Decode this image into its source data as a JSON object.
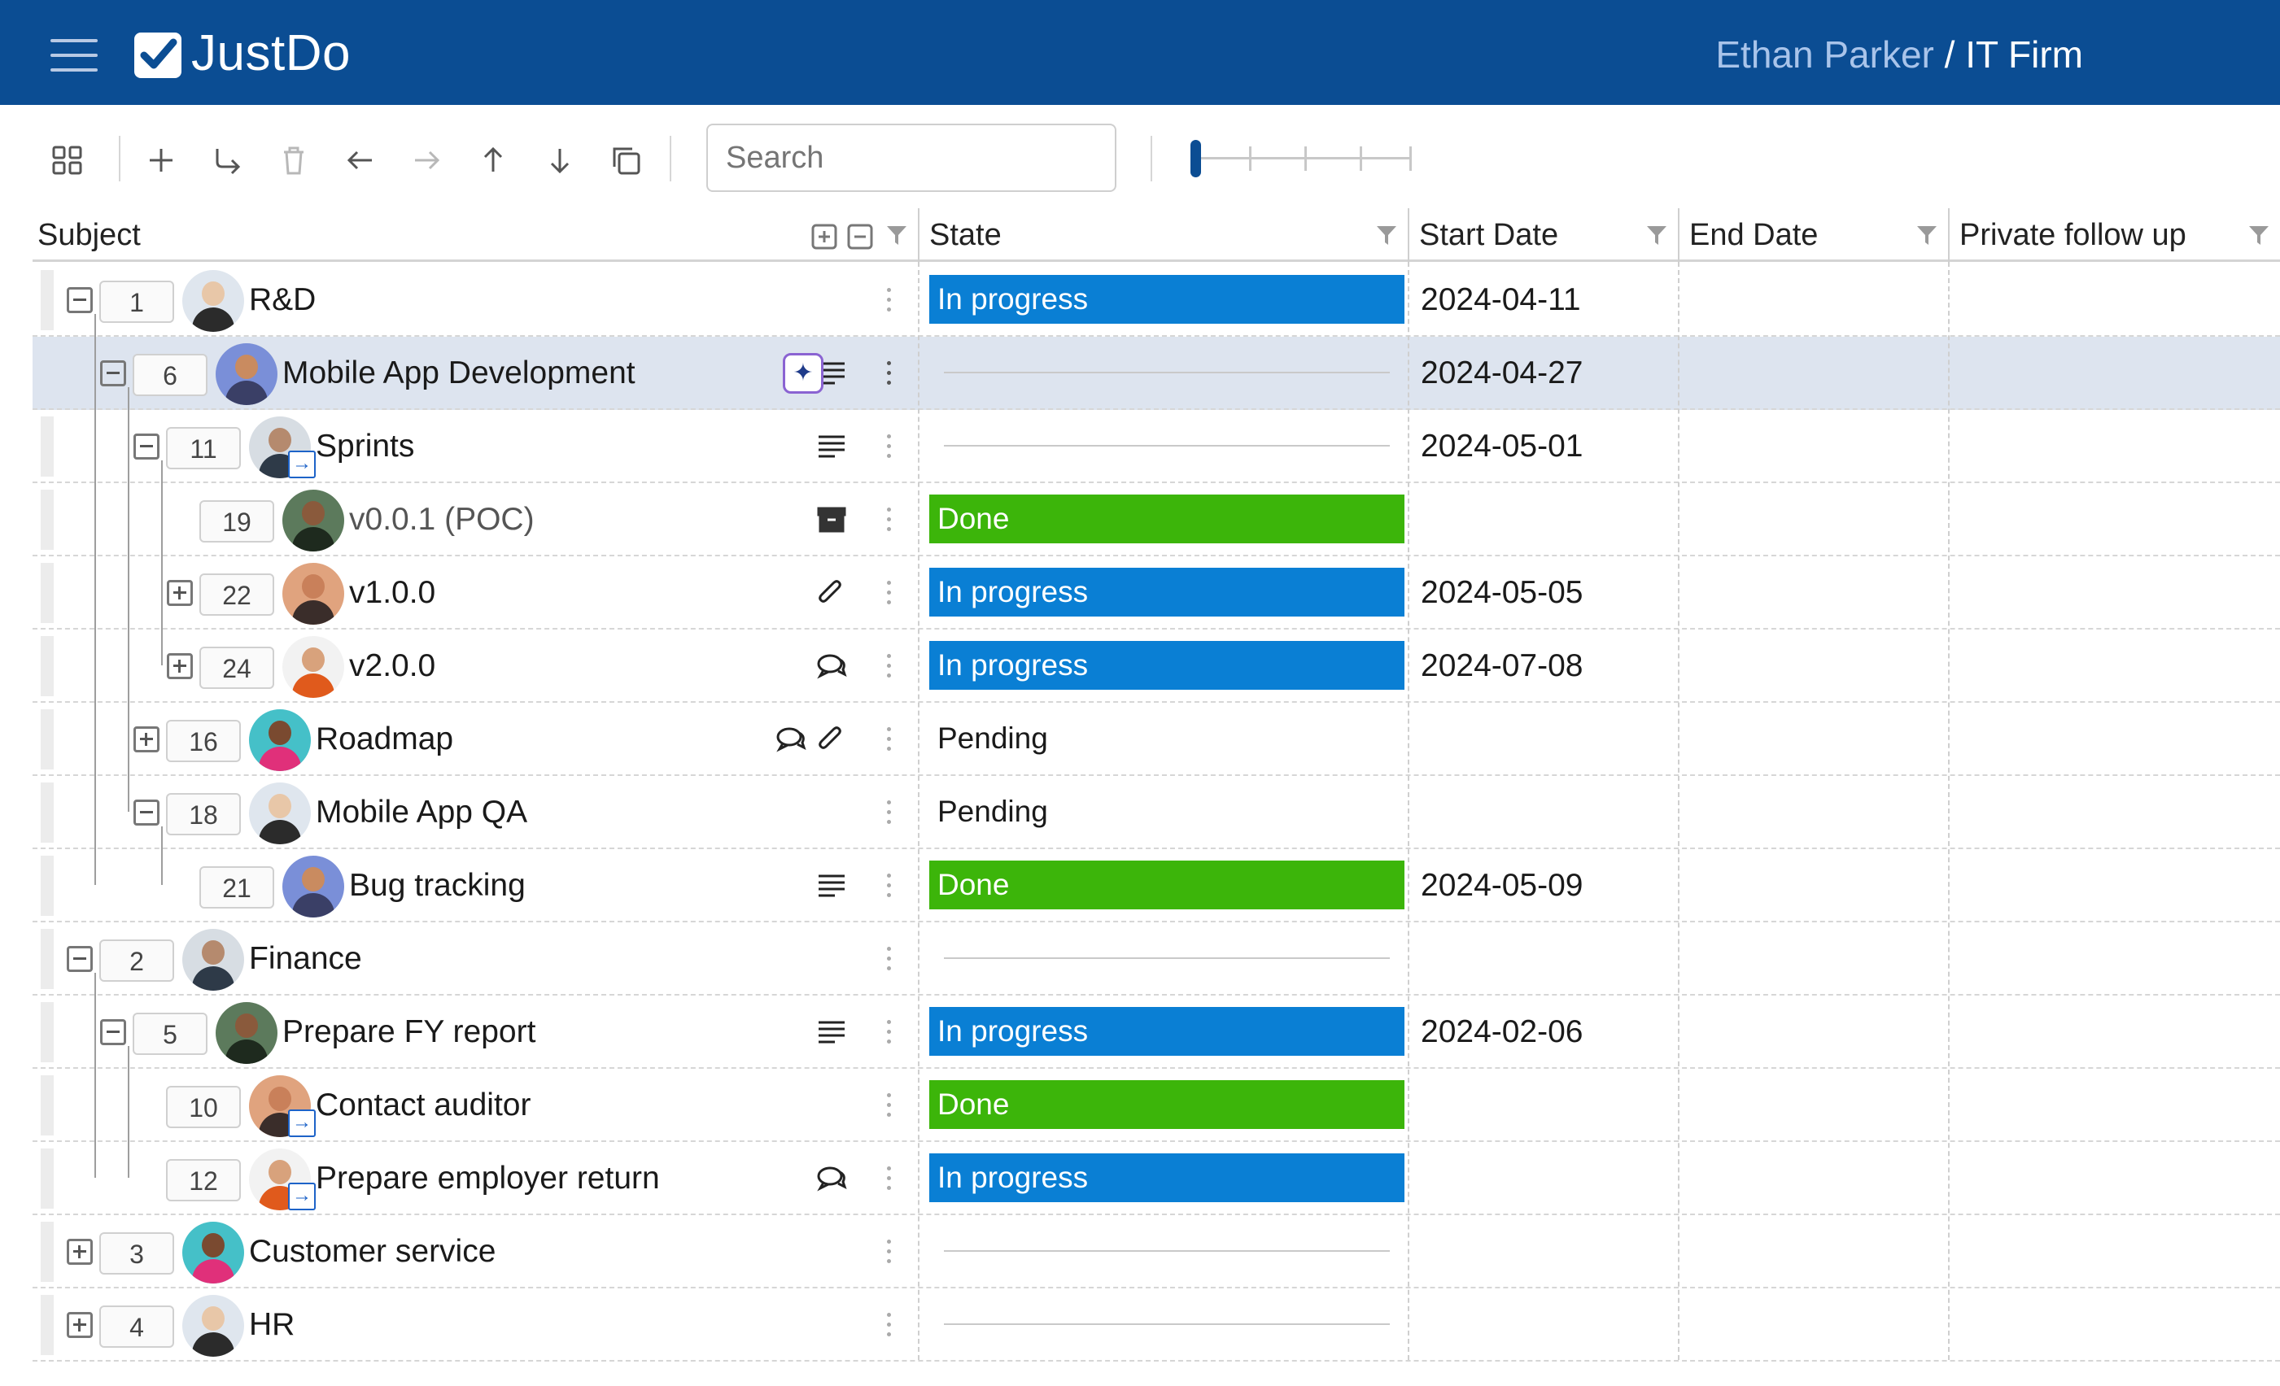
{
  "app": {
    "logo_text": "JustDo",
    "user_name": "Ethan Parker",
    "org_separator": " / ",
    "org_name": "IT Firm"
  },
  "toolbar": {
    "search_placeholder": "Search",
    "icons": [
      "grid-icon",
      "plus-icon",
      "subtask-arrow-icon",
      "trash-icon",
      "arrow-left-icon",
      "arrow-right-icon",
      "arrow-up-icon",
      "arrow-down-icon",
      "duplicate-icon"
    ]
  },
  "columns": {
    "subject": "Subject",
    "state": "State",
    "start_date": "Start Date",
    "end_date": "End Date",
    "private_follow_up": "Private follow up"
  },
  "colors": {
    "header_bg": "#0b4d93",
    "in_progress": "#0a7fd4",
    "done": "#3cb50a",
    "selected_row": "#dde4ef",
    "ai_border": "#8a63d2"
  },
  "rows": [
    {
      "seq": "1",
      "subject": "R&D",
      "level": 0,
      "toggle": "minus",
      "state": "In progress",
      "state_type": "inprog",
      "start_date": "2024-04-11",
      "icons": []
    },
    {
      "seq": "6",
      "subject": "Mobile App Development",
      "level": 1,
      "toggle": "minus",
      "state": "",
      "state_type": "empty",
      "start_date": "2024-04-27",
      "icons": [
        "ai-sparkle-icon",
        "description-icon"
      ],
      "selected": true
    },
    {
      "seq": "11",
      "subject": "Sprints",
      "level": 2,
      "toggle": "minus",
      "state": "",
      "state_type": "empty",
      "start_date": "2024-05-01",
      "icons": [
        "description-icon"
      ],
      "delegated": true
    },
    {
      "seq": "19",
      "subject": "v0.0.1 (POC)",
      "level": 3,
      "toggle": "none",
      "state": "Done",
      "state_type": "done",
      "start_date": "",
      "icons": [
        "archive-icon"
      ],
      "muted": true
    },
    {
      "seq": "22",
      "subject": "v1.0.0",
      "level": 3,
      "toggle": "plus",
      "state": "In progress",
      "state_type": "inprog",
      "start_date": "2024-05-05",
      "icons": [
        "paperclip-icon"
      ]
    },
    {
      "seq": "24",
      "subject": "v2.0.0",
      "level": 3,
      "toggle": "plus",
      "state": "In progress",
      "state_type": "inprog",
      "start_date": "2024-07-08",
      "icons": [
        "chat-icon"
      ]
    },
    {
      "seq": "16",
      "subject": "Roadmap",
      "level": 2,
      "toggle": "plus",
      "state": "Pending",
      "state_type": "pending",
      "start_date": "",
      "icons": [
        "chat-icon",
        "paperclip-icon"
      ]
    },
    {
      "seq": "18",
      "subject": "Mobile App QA",
      "level": 2,
      "toggle": "minus",
      "state": "Pending",
      "state_type": "pending",
      "start_date": "",
      "icons": []
    },
    {
      "seq": "21",
      "subject": "Bug tracking",
      "level": 3,
      "toggle": "none",
      "state": "Done",
      "state_type": "done",
      "start_date": "2024-05-09",
      "icons": [
        "description-icon"
      ]
    },
    {
      "seq": "2",
      "subject": "Finance",
      "level": 0,
      "toggle": "minus",
      "state": "",
      "state_type": "empty",
      "start_date": "",
      "icons": []
    },
    {
      "seq": "5",
      "subject": "Prepare FY report",
      "level": 1,
      "toggle": "minus",
      "state": "In progress",
      "state_type": "inprog",
      "start_date": "2024-02-06",
      "icons": [
        "description-icon"
      ]
    },
    {
      "seq": "10",
      "subject": "Contact auditor",
      "level": 2,
      "toggle": "none",
      "state": "Done",
      "state_type": "done",
      "start_date": "",
      "icons": [],
      "delegated": true
    },
    {
      "seq": "12",
      "subject": "Prepare employer return",
      "level": 2,
      "toggle": "none",
      "state": "In progress",
      "state_type": "inprog",
      "start_date": "",
      "icons": [
        "chat-icon"
      ],
      "delegated": true
    },
    {
      "seq": "3",
      "subject": "Customer service",
      "level": 0,
      "toggle": "plus",
      "state": "",
      "state_type": "empty",
      "start_date": "",
      "icons": []
    },
    {
      "seq": "4",
      "subject": "HR",
      "level": 0,
      "toggle": "plus",
      "state": "",
      "state_type": "empty",
      "start_date": "",
      "icons": []
    }
  ]
}
